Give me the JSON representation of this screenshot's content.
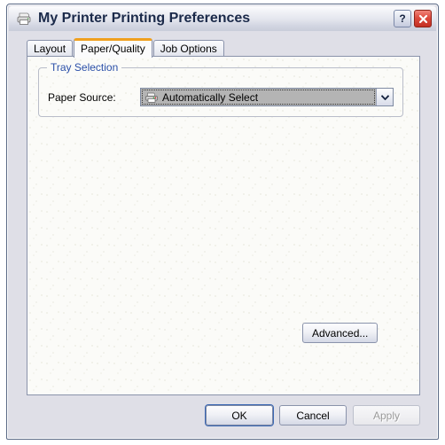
{
  "window": {
    "title": "My Printer Printing Preferences",
    "icon": "printer-icon",
    "help_label": "?",
    "close_label": "✕",
    "accent_active_tab": "#f0a01e",
    "title_color": "#1b2a4a",
    "group_title_color": "#2a4fa8"
  },
  "tabs": [
    {
      "label": "Layout",
      "active": false
    },
    {
      "label": "Paper/Quality",
      "active": true
    },
    {
      "label": "Job Options",
      "active": false
    }
  ],
  "panel": {
    "group": {
      "title": "Tray Selection",
      "fields": [
        {
          "label": "Paper Source:",
          "value": "Automatically Select",
          "icon": "printer-icon",
          "selected": true
        }
      ]
    },
    "advanced_button": "Advanced..."
  },
  "footer": {
    "buttons": [
      {
        "label": "OK",
        "state": "default"
      },
      {
        "label": "Cancel",
        "state": "normal"
      },
      {
        "label": "Apply",
        "state": "disabled"
      }
    ]
  }
}
